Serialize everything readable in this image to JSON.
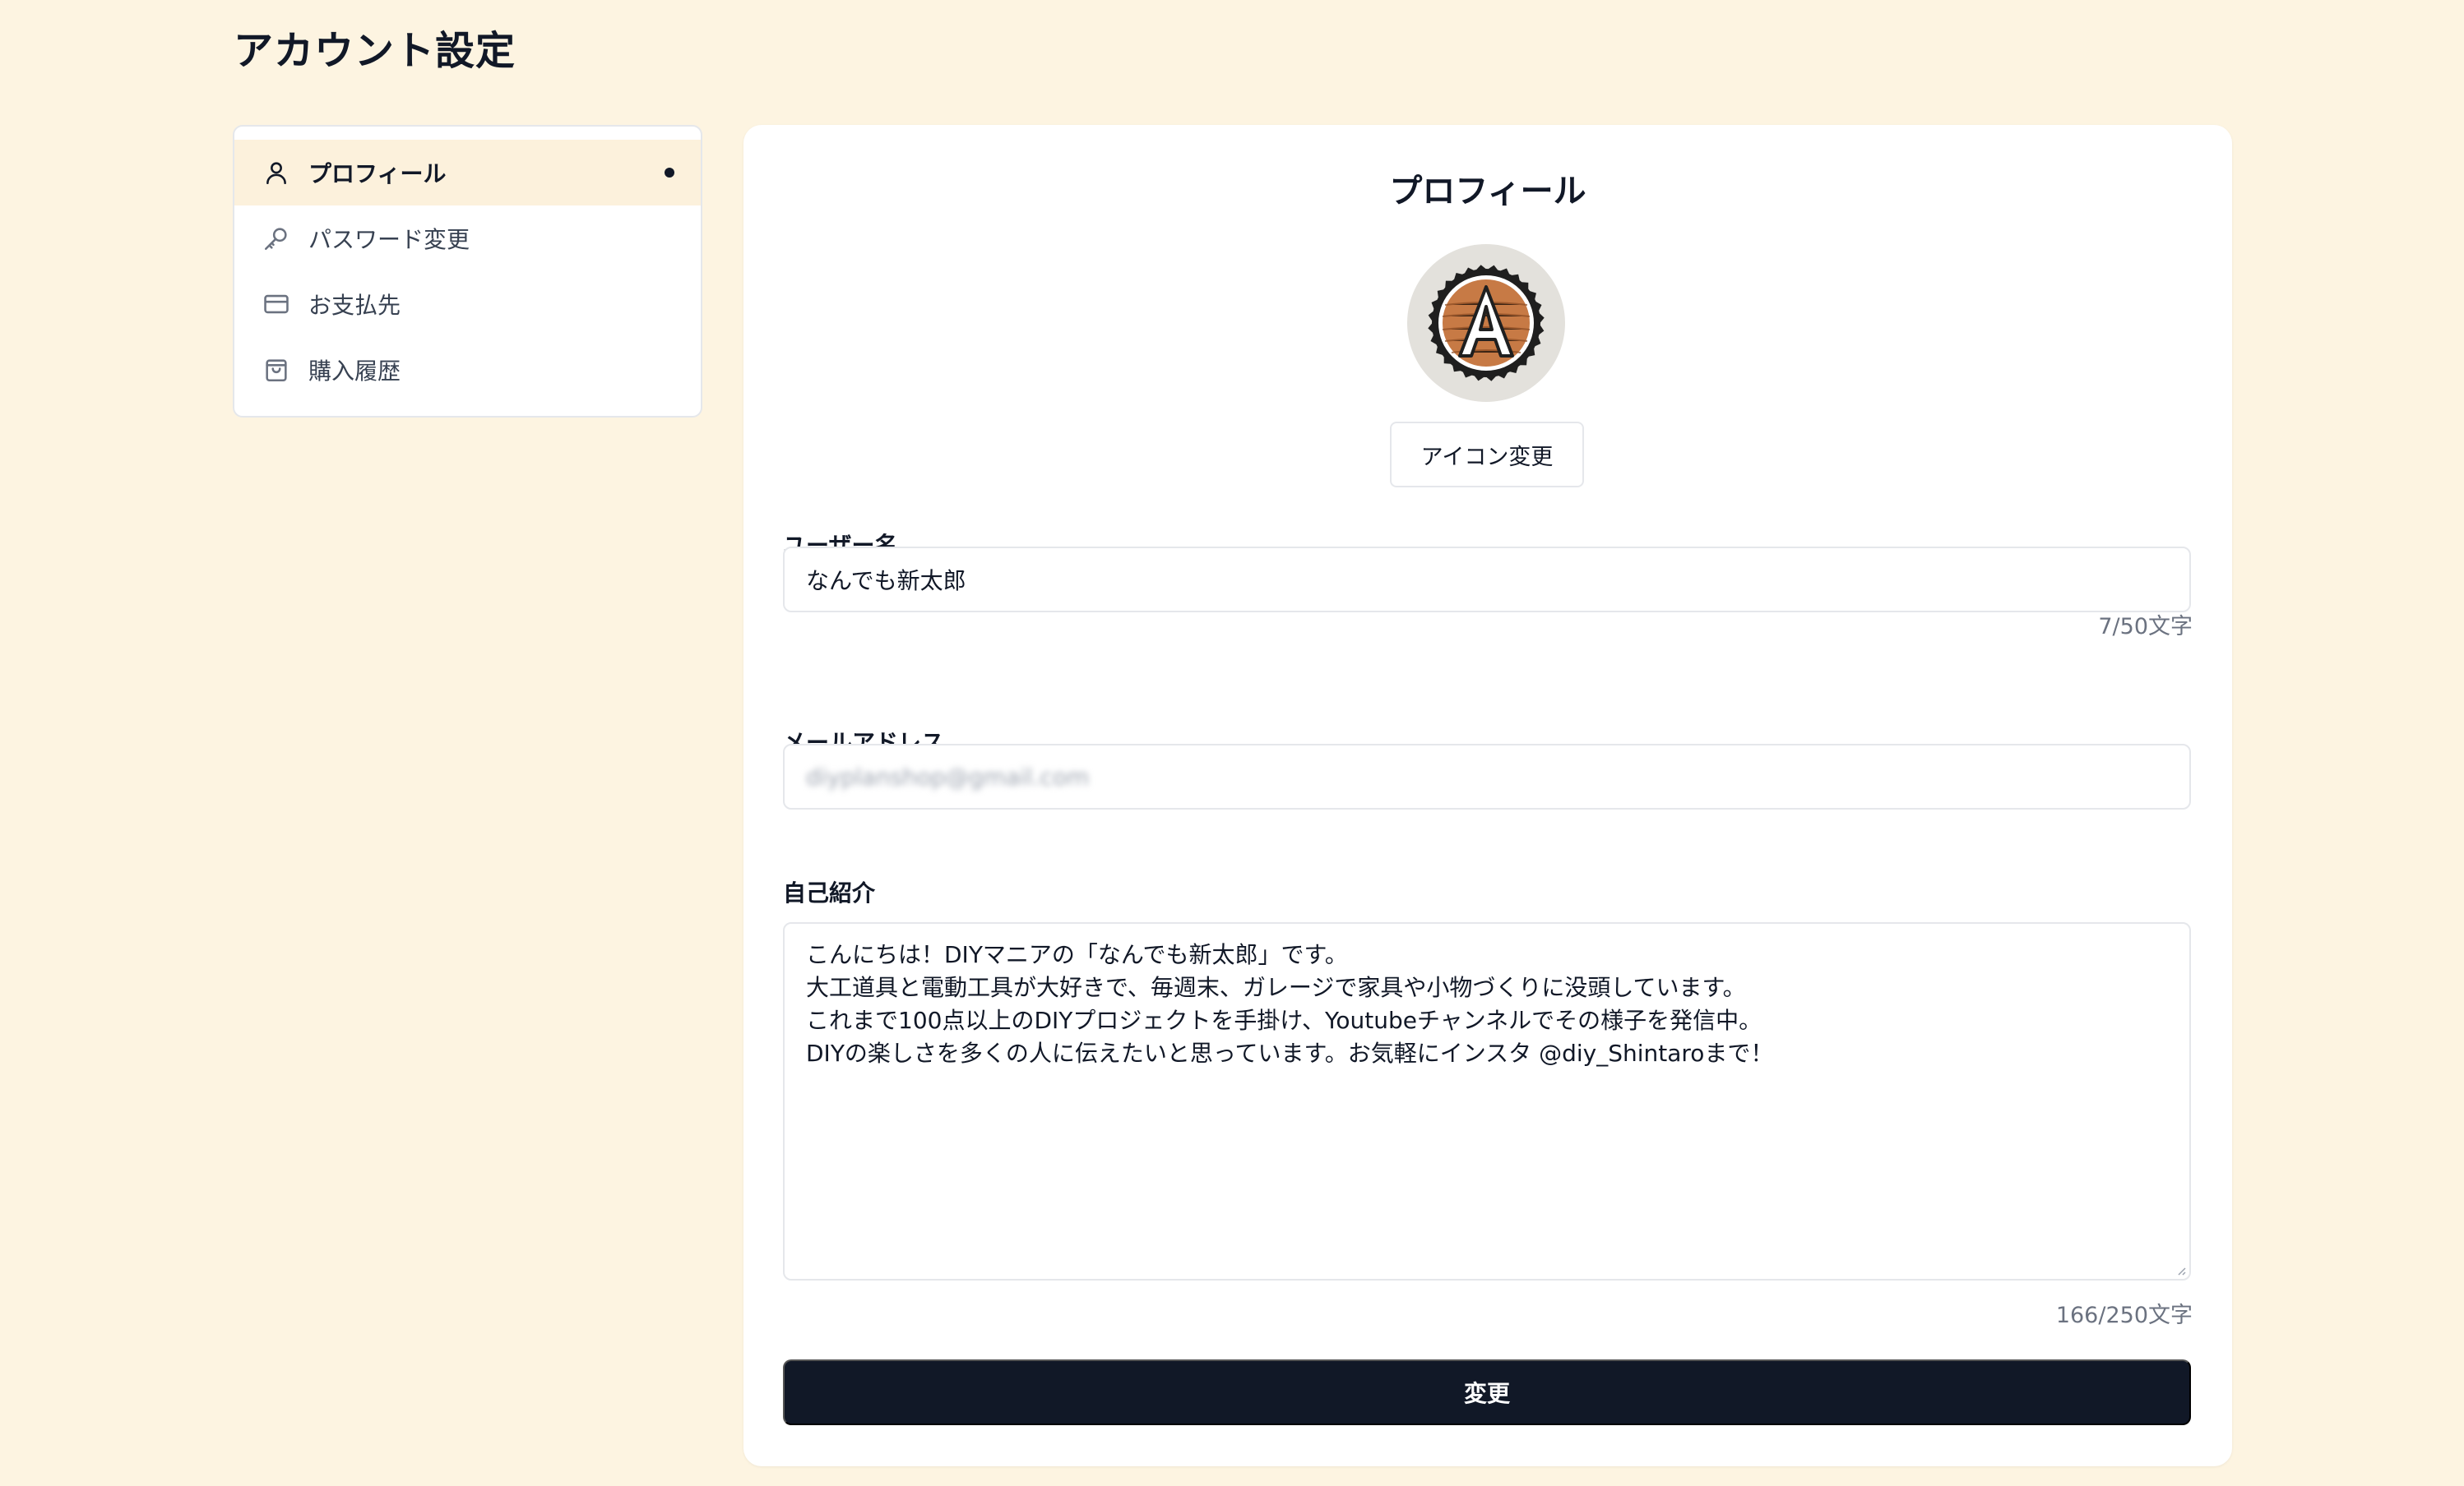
{
  "page": {
    "title": "アカウント設定"
  },
  "sidebar": {
    "items": [
      {
        "label": "プロフィール",
        "icon": "user-icon",
        "active": true
      },
      {
        "label": "パスワード変更",
        "icon": "key-icon",
        "active": false
      },
      {
        "label": "お支払先",
        "icon": "credit-card-icon",
        "active": false
      },
      {
        "label": "購入履歴",
        "icon": "shopping-bag-icon",
        "active": false
      }
    ]
  },
  "profile": {
    "title": "プロフィール",
    "avatar_letter": "A",
    "icon_change_label": "アイコン変更",
    "username_label": "ユーザー名",
    "username_value": "なんでも新太郎",
    "username_counter": "7/50文字",
    "email_label": "メールアドレス",
    "email_value": "diyplanshop@gmail.com",
    "bio_label": "自己紹介",
    "bio_lines": [
      "こんにちは！DIYマニアの「なんでも新太郎」です。",
      "大工道具と電動工具が大好きで、毎週末、ガレージで家具や小物づくりに没頭しています。",
      "これまで100点以上のDIYプロジェクトを手掛け、Youtubeチャンネルでその様子を発信中。",
      "DIYの楽しさを多くの人に伝えたいと思っています。お気軽にインスタ @diy_Shintaroまで！"
    ],
    "bio_counter": "166/250文字",
    "submit_label": "変更"
  },
  "colors": {
    "background": "#fdf4e1",
    "active_item": "#fcf1dc",
    "primary_button": "#111827",
    "avatar_wood": "#c77a45"
  }
}
